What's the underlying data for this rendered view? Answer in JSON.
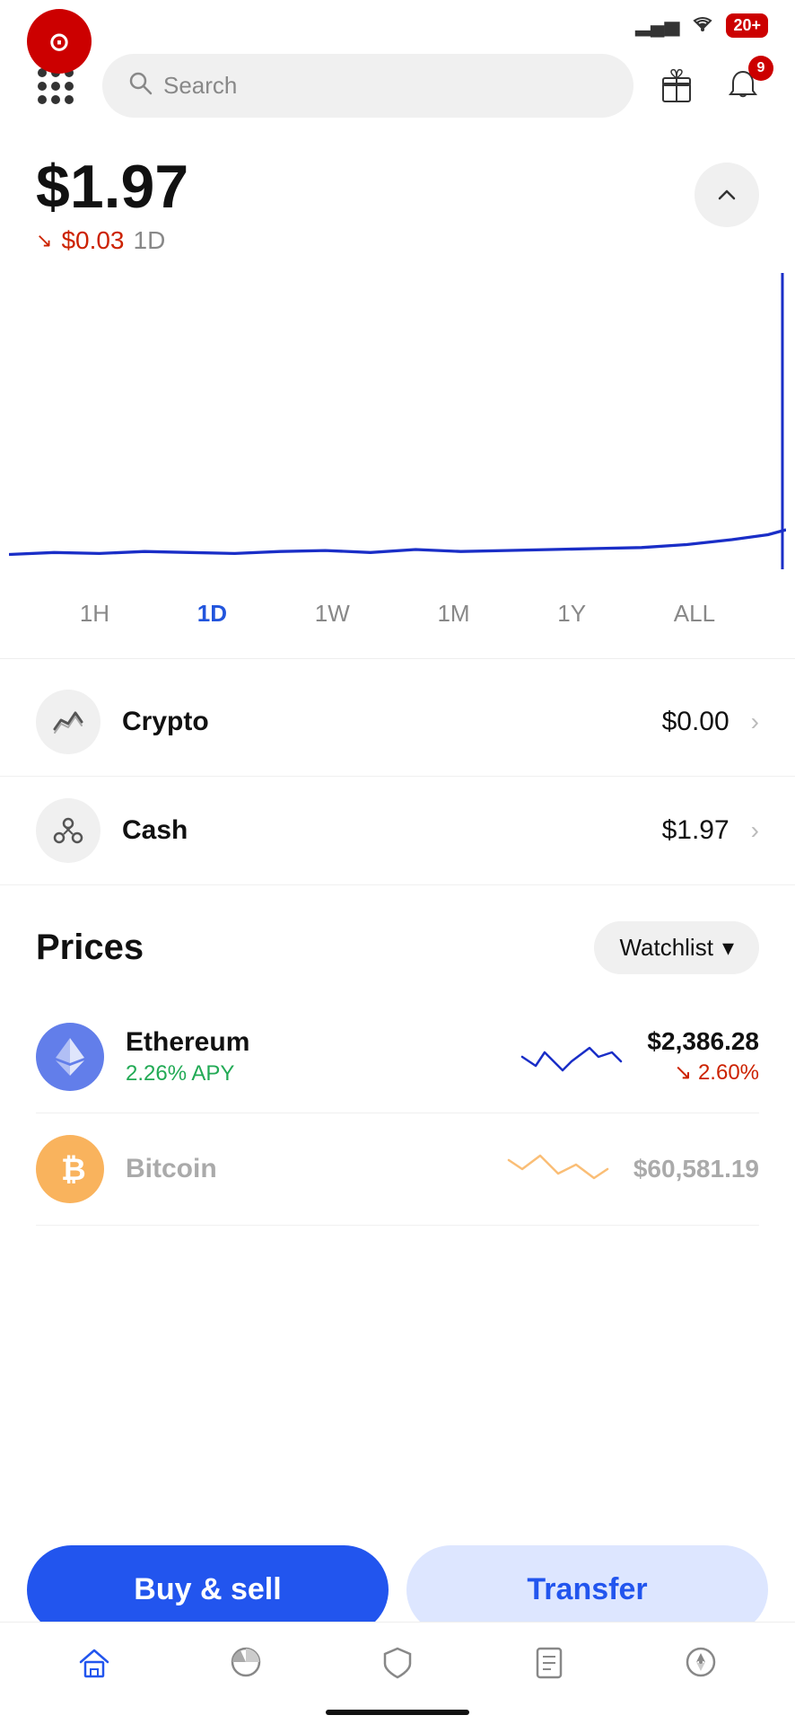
{
  "statusBar": {
    "signal": "▂▄▅",
    "wifi": "WiFi",
    "battery": "20+"
  },
  "logo": {
    "symbol": "⊙"
  },
  "search": {
    "placeholder": "Search"
  },
  "notifications": {
    "count": "9"
  },
  "portfolio": {
    "value": "$1.97",
    "change": "$0.03",
    "changeArrow": "↘",
    "period": "1D"
  },
  "timeFilters": [
    {
      "label": "1H",
      "active": false
    },
    {
      "label": "1D",
      "active": true
    },
    {
      "label": "1W",
      "active": false
    },
    {
      "label": "1M",
      "active": false
    },
    {
      "label": "1Y",
      "active": false
    },
    {
      "label": "ALL",
      "active": false
    }
  ],
  "holdings": [
    {
      "name": "Crypto",
      "value": "$0.00"
    },
    {
      "name": "Cash",
      "value": "$1.97"
    }
  ],
  "prices": {
    "title": "Prices",
    "watchlistLabel": "Watchlist"
  },
  "coins": [
    {
      "name": "Ethereum",
      "apy": "2.26% APY",
      "price": "$2,386.28",
      "change": "↘ 2.60%",
      "muted": false
    },
    {
      "name": "Bitcoin",
      "apy": "",
      "price": "$60,581.19",
      "change": "",
      "muted": true
    }
  ],
  "actions": {
    "buySell": "Buy & sell",
    "transfer": "Transfer"
  },
  "bottomNav": [
    {
      "icon": "🏠",
      "name": "home",
      "active": true
    },
    {
      "icon": "◑",
      "name": "portfolio",
      "active": false
    },
    {
      "icon": "🛡",
      "name": "security",
      "active": false
    },
    {
      "icon": "📋",
      "name": "activity",
      "active": false
    },
    {
      "icon": "🧭",
      "name": "discover",
      "active": false
    }
  ]
}
